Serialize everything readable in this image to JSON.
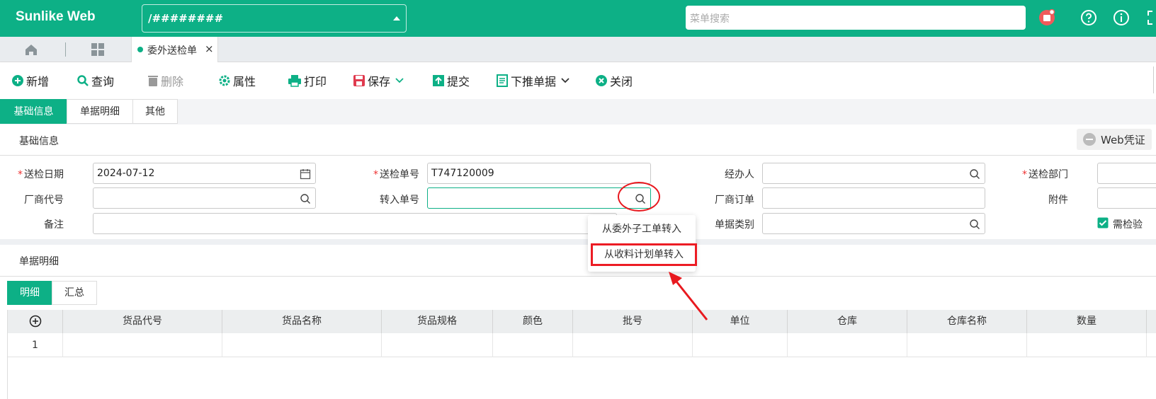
{
  "app": {
    "brand": "Sunlike Web",
    "path_value": "/########",
    "menu_search_placeholder": "菜单搜索"
  },
  "tabs": {
    "active_label": "委外送检单",
    "close_glyph": "×"
  },
  "toolbar": {
    "new": "新增",
    "query": "查询",
    "delete": "删除",
    "props": "属性",
    "print": "打印",
    "save": "保存",
    "submit": "提交",
    "push": "下推单据",
    "close": "关闭"
  },
  "subtabs": [
    "基础信息",
    "单据明细",
    "其他"
  ],
  "basic": {
    "section_title": "基础信息",
    "web_voucher": "Web凭证"
  },
  "form": {
    "date_label": "送检日期",
    "date_value": "2024-07-12",
    "order_no_label": "送检单号",
    "order_no_value": "T747120009",
    "handler_label": "经办人",
    "dept_label": "送检部门",
    "vendor_label": "厂商代号",
    "transfer_label": "转入单号",
    "vendor_order_label": "厂商订单",
    "attach_label": "附件",
    "remark_label": "备注",
    "doc_type_label": "单据类别",
    "need_check_label": "需检验"
  },
  "dropdown": {
    "items": [
      "从委外子工单转入",
      "从收料计划单转入"
    ]
  },
  "detail": {
    "section_title": "单据明细",
    "tabs": [
      "明细",
      "汇总"
    ]
  },
  "grid": {
    "columns": [
      "货品代号",
      "货品名称",
      "货品规格",
      "颜色",
      "批号",
      "单位",
      "仓库",
      "仓库名称",
      "数量"
    ],
    "rows": [
      {
        "index": "1"
      }
    ]
  },
  "colors": {
    "accent": "#0db086",
    "annotation": "#e8191f"
  }
}
